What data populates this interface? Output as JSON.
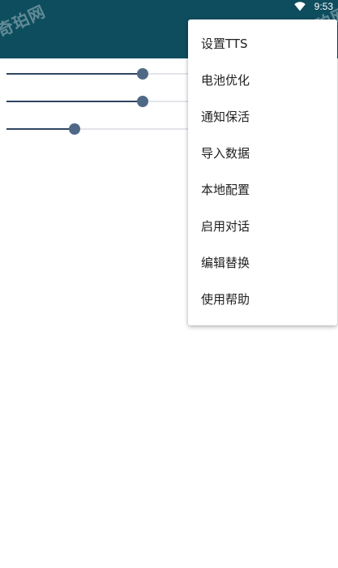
{
  "status_bar": {
    "time": "9:53",
    "wifi_icon": "wifi-icon"
  },
  "watermark": {
    "text": "奇珀网"
  },
  "colors": {
    "app_bar": "#0d4d5e",
    "slider_fill": "#2e4660",
    "slider_thumb": "#4f6886",
    "slider_track": "#e2e5ea"
  },
  "sliders": [
    {
      "value": 0.42
    },
    {
      "value": 0.42
    },
    {
      "value": 0.21
    }
  ],
  "menu": {
    "items": [
      {
        "label": "设置TTS"
      },
      {
        "label": "电池优化"
      },
      {
        "label": "通知保活"
      },
      {
        "label": "导入数据"
      },
      {
        "label": "本地配置"
      },
      {
        "label": "启用对话"
      },
      {
        "label": "编辑替换"
      },
      {
        "label": "使用帮助"
      }
    ]
  }
}
